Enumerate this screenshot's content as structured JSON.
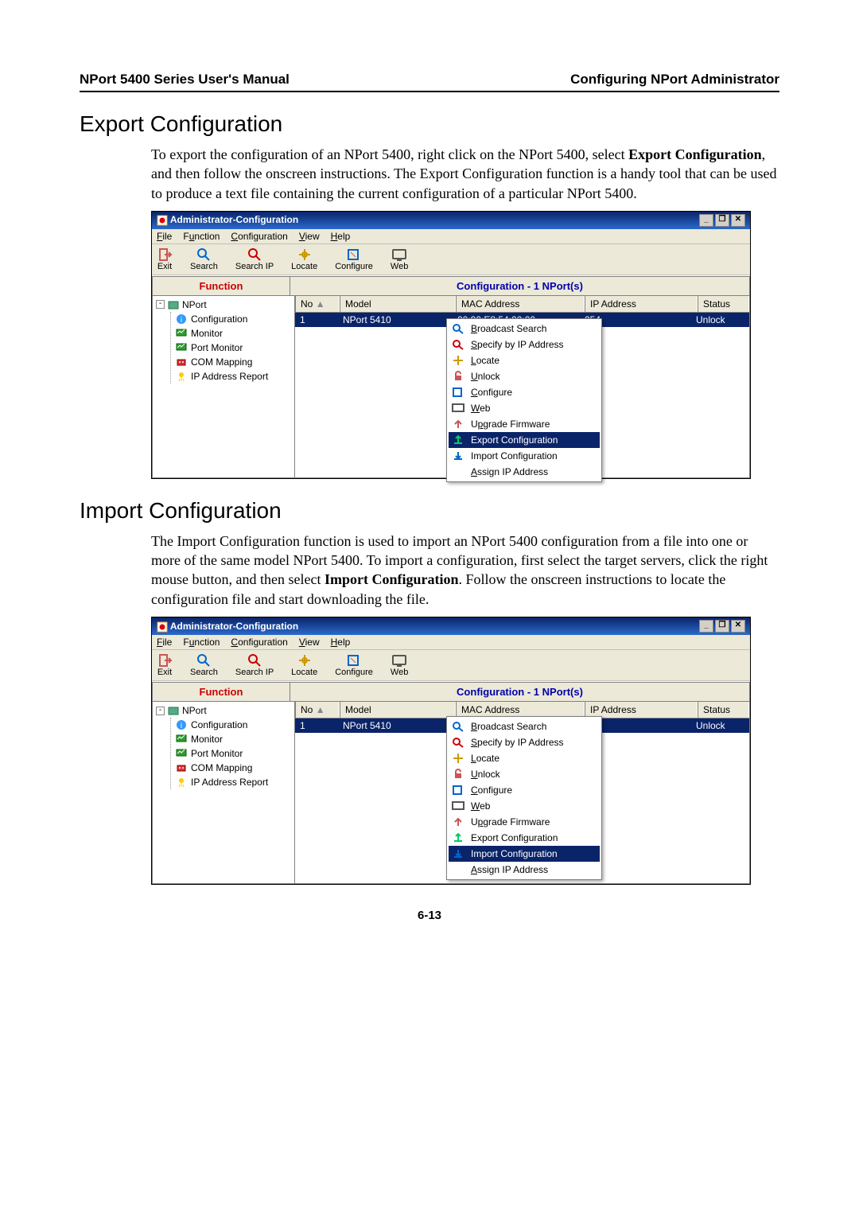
{
  "header": {
    "left": "NPort 5400 Series User's Manual",
    "right": "Configuring NPort Administrator"
  },
  "section1": {
    "title": "Export Configuration",
    "para_a": "To export the configuration of an NPort 5400, right click on the NPort 5400, select ",
    "para_b": "Export Configuration",
    "para_c": ", and then follow the onscreen instructions. The Export Configuration function is a handy tool that can be used to produce a text file containing the current configuration of a particular NPort 5400."
  },
  "section2": {
    "title": "Import Configuration",
    "para_a": "The Import Configuration function is used to import an NPort 5400 configuration from a file into one or more of the same model NPort 5400. To import a configuration, first select the target servers, click the right mouse button, and then select ",
    "para_b": "Import Configuration",
    "para_c": ". Follow the onscreen instructions to locate the configuration file and start downloading the file."
  },
  "app": {
    "title": "Administrator-Configuration",
    "menu": {
      "file": "File",
      "function": "Function",
      "configuration": "Configuration",
      "view": "View",
      "help": "Help"
    },
    "toolbar": {
      "exit": "Exit",
      "search": "Search",
      "searchip": "Search IP",
      "locate": "Locate",
      "configure": "Configure",
      "web": "Web"
    },
    "panes": {
      "left": "Function",
      "right": "Configuration - 1 NPort(s)"
    },
    "tree": {
      "root": "NPort",
      "items": [
        "Configuration",
        "Monitor",
        "Port Monitor",
        "COM Mapping",
        "IP Address Report"
      ]
    },
    "grid": {
      "cols": {
        "no": "No",
        "model": "Model",
        "mac": "MAC Address",
        "ip": "IP Address",
        "status": "Status"
      },
      "row": {
        "no": "1",
        "model": "NPort 5410",
        "mac": "00:90:E8:54:00:00",
        "ip_tail": "254",
        "status": "Unlock"
      }
    },
    "context": {
      "broadcast": "Broadcast Search",
      "specify": "Specify by IP Address",
      "locate": "Locate",
      "unlock": "Unlock",
      "configure": "Configure",
      "web": "Web",
      "upgrade": "Upgrade Firmware",
      "export": "Export Configuration",
      "import": "Import Configuration",
      "assign": "Assign IP Address"
    }
  },
  "page_number": "6-13"
}
